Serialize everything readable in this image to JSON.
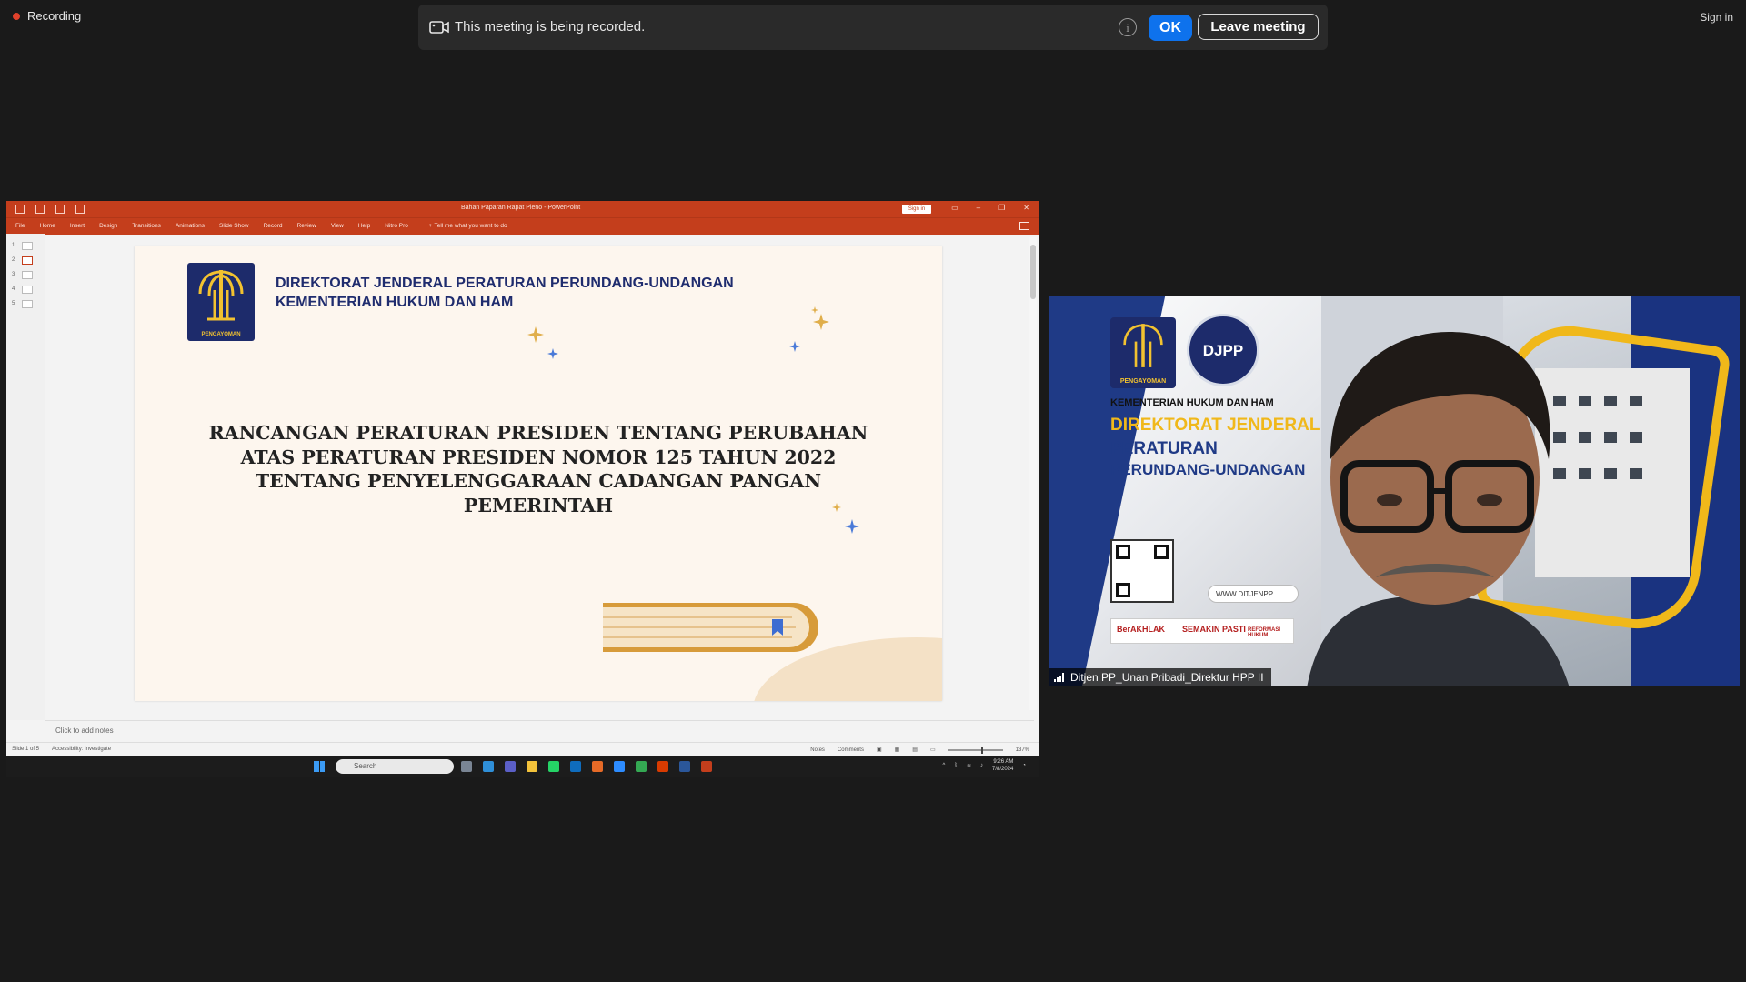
{
  "recording": {
    "label": "Recording",
    "dot_color": "#e0412b"
  },
  "banner": {
    "message": "This meeting is being recorded.",
    "info_glyph": "i",
    "ok_label": "OK",
    "leave_label": "Leave meeting",
    "ok_color": "#0e72ed"
  },
  "top_right": {
    "signin_label": "Sign in"
  },
  "powerpoint": {
    "doc_title": "Bahan Paparan Rapat Pleno - PowerPoint",
    "signin_label": "Sign in",
    "brand_color": "#c43e1c",
    "menu": [
      "File",
      "Home",
      "Insert",
      "Design",
      "Transitions",
      "Animations",
      "Slide Show",
      "Record",
      "Review",
      "View",
      "Help",
      "Nitro Pro"
    ],
    "tell_me": "Tell me what you want to do",
    "thumbnails": [
      "1",
      "2",
      "3",
      "4",
      "5"
    ],
    "slide": {
      "logo_caption": "PENGAYOMAN",
      "header_line1": "DIREKTORAT JENDERAL PERATURAN PERUNDANG-UNDANGAN",
      "header_line2": "KEMENTERIAN HUKUM DAN HAM",
      "title_lines": [
        "RANCANGAN PERATURAN PRESIDEN TENTANG PERUBAHAN",
        "ATAS PERATURAN PRESIDEN NOMOR 125 TAHUN 2022",
        "TENTANG PENYELENGGARAAN CADANGAN PANGAN",
        "PEMERINTAH"
      ]
    },
    "notes_placeholder": "Click to add notes",
    "status": {
      "slide_counter": "Slide 1 of 5",
      "accessibility": "Accessibility: Investigate",
      "notes_label": "Notes",
      "comments_label": "Comments",
      "zoom": "137%"
    }
  },
  "taskbar": {
    "search_placeholder": "Search",
    "time": "9:26 AM",
    "date": "7/8/2024"
  },
  "participant": {
    "name": "Ditjen PP_Unan Pribadi_Direktur HPP II",
    "bg_logo1_caption": "PENGAYOMAN",
    "bg_logo2_text": "DJPP",
    "bg_ministry": "KEMENTERIAN HUKUM DAN HAM",
    "bg_dir": "DIREKTORAT JENDERAL",
    "bg_line1": "PERATURAN",
    "bg_line2": "PERUNDANG-UNDANGAN",
    "bg_url": "WWW.DITJENPP",
    "bg_badge1": "BerAKHLAK",
    "bg_badge2": "SEMAKIN PASTI",
    "bg_badge3": "REFORMASI HUKUM"
  }
}
